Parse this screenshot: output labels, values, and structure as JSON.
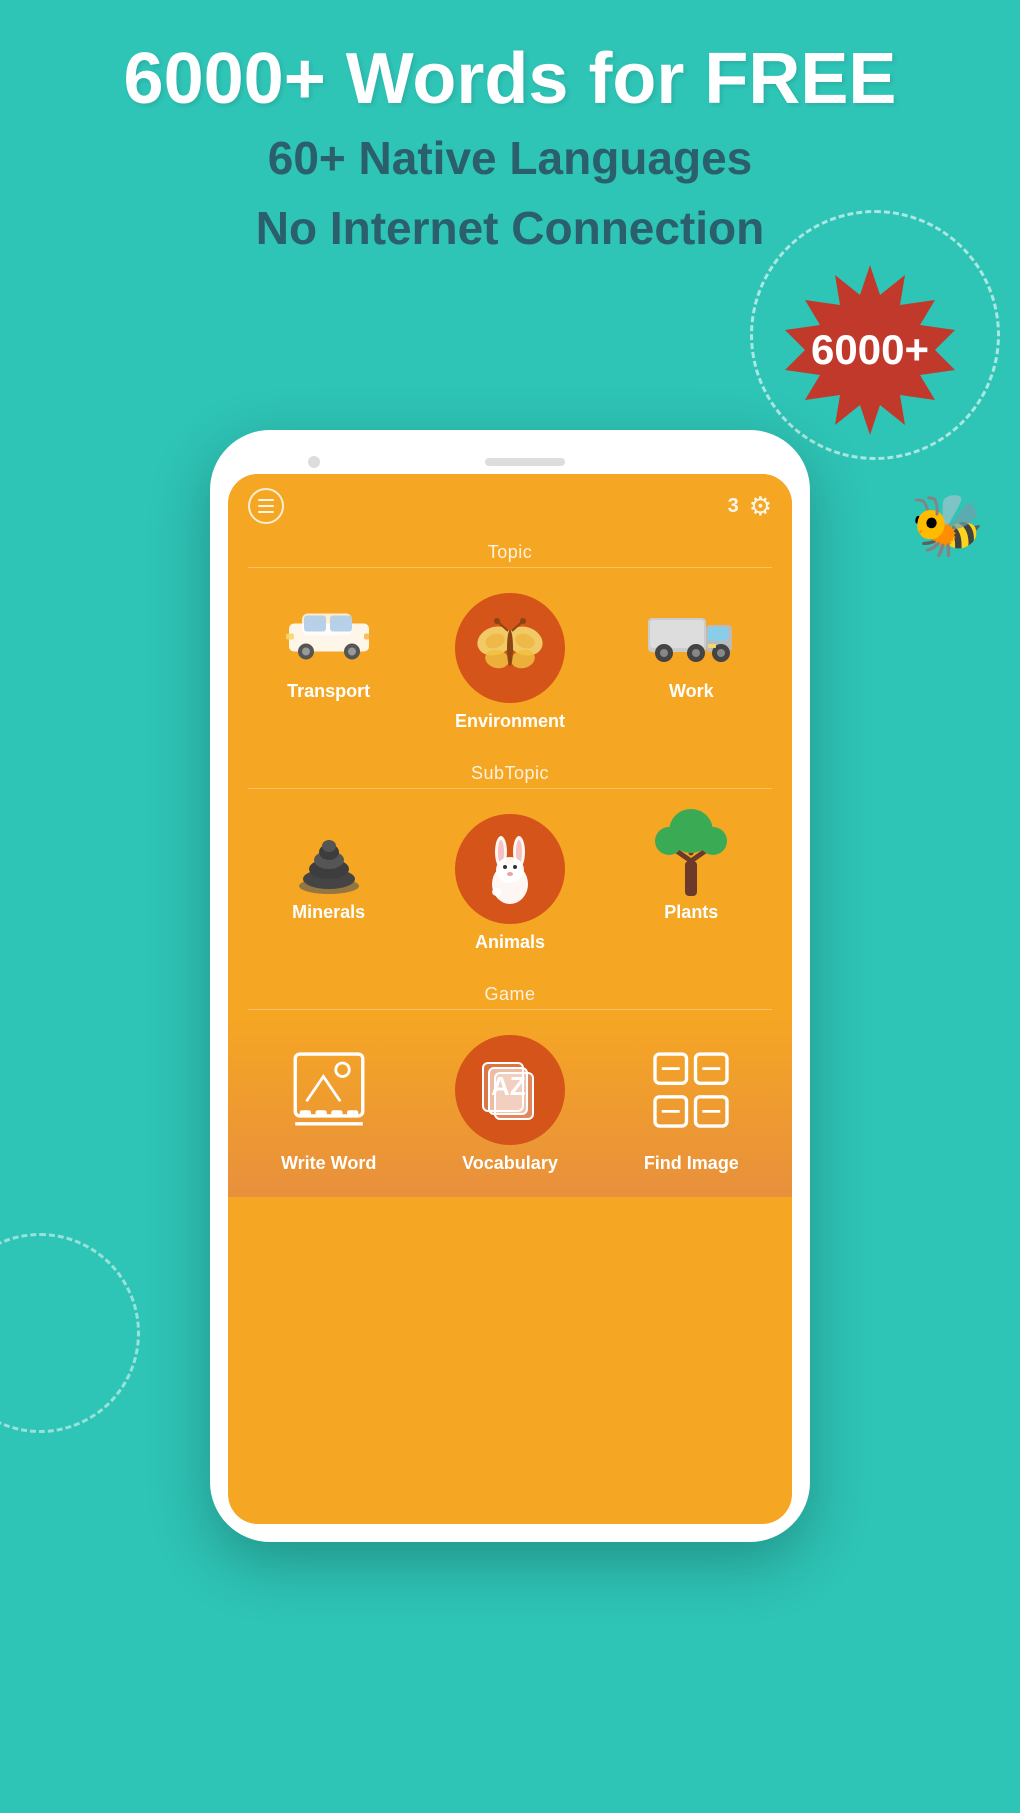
{
  "header": {
    "title": "6000+ Words  for FREE",
    "subtitle1": "60+ Native Languages",
    "subtitle2": "No Internet Connection"
  },
  "badge": {
    "label": "6000+"
  },
  "appbar": {
    "count": "3"
  },
  "sections": {
    "topic_label": "Topic",
    "subtopic_label": "SubTopic",
    "game_label": "Game"
  },
  "topics": [
    {
      "label": "Transport"
    },
    {
      "label": "Environment"
    },
    {
      "label": "Work"
    }
  ],
  "subtopics": [
    {
      "label": "Minerals"
    },
    {
      "label": "Animals"
    },
    {
      "label": "Plants"
    }
  ],
  "games": [
    {
      "label": "Write Word"
    },
    {
      "label": "Vocabulary"
    },
    {
      "label": "Find Image"
    }
  ]
}
